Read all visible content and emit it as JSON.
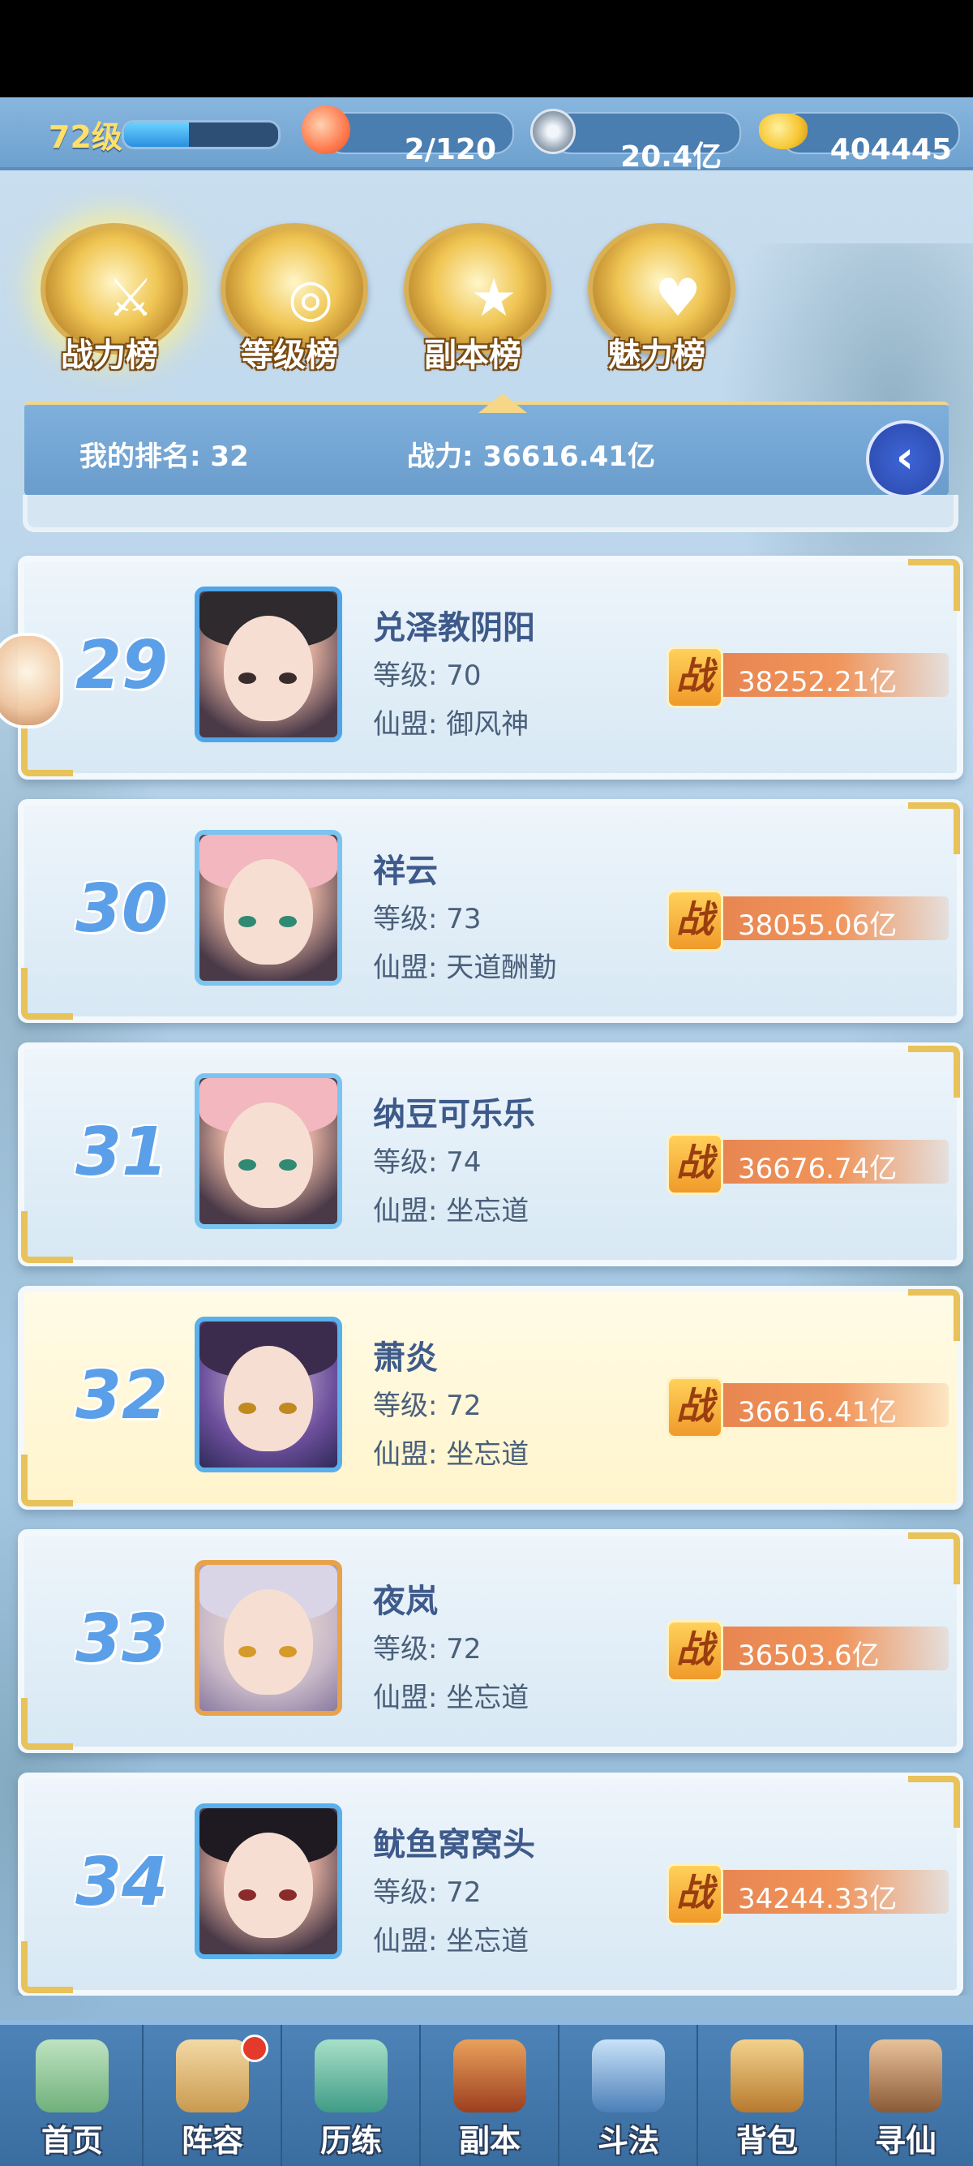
{
  "resources": {
    "level": "72级",
    "exp_fraction": 0.42,
    "stamina": "2/120",
    "silver": "20.4亿",
    "gold": "404445"
  },
  "tabs": [
    {
      "label": "战力榜",
      "icon": "sword-emblem-icon",
      "active": true
    },
    {
      "label": "等级榜",
      "icon": "drum-emblem-icon",
      "active": false
    },
    {
      "label": "副本榜",
      "icon": "star-emblem-icon",
      "active": false
    },
    {
      "label": "魅力榜",
      "icon": "heart-emblem-icon",
      "active": false
    }
  ],
  "my_rank": {
    "rank_text": "我的排名: 32",
    "power_text": "战力: 36616.41亿"
  },
  "players": [
    {
      "rank": "29",
      "name": "兑泽教阴阳",
      "level": "等级: 70",
      "guild": "仙盟: 御风神",
      "power": "38252.21亿",
      "highlight": false
    },
    {
      "rank": "30",
      "name": "祥云",
      "level": "等级: 73",
      "guild": "仙盟: 天道酬勤",
      "power": "38055.06亿",
      "highlight": false
    },
    {
      "rank": "31",
      "name": "纳豆可乐乐",
      "level": "等级: 74",
      "guild": "仙盟: 坐忘道",
      "power": "36676.74亿",
      "highlight": false
    },
    {
      "rank": "32",
      "name": "萧炎",
      "level": "等级: 72",
      "guild": "仙盟: 坐忘道",
      "power": "36616.41亿",
      "highlight": true
    },
    {
      "rank": "33",
      "name": "夜岚",
      "level": "等级: 72",
      "guild": "仙盟: 坐忘道",
      "power": "36503.6亿",
      "highlight": false
    },
    {
      "rank": "34",
      "name": "鱿鱼窝窝头",
      "level": "等级: 72",
      "guild": "仙盟: 坐忘道",
      "power": "34244.33亿",
      "highlight": false
    }
  ],
  "power_badge": "战",
  "nav": [
    {
      "label": "首页",
      "icon": "home-icon"
    },
    {
      "label": "阵容",
      "icon": "lineup-icon",
      "badge": true
    },
    {
      "label": "历练",
      "icon": "training-icon"
    },
    {
      "label": "副本",
      "icon": "dungeon-icon"
    },
    {
      "label": "斗法",
      "icon": "battle-icon"
    },
    {
      "label": "背包",
      "icon": "bag-icon"
    },
    {
      "label": "寻仙",
      "icon": "seek-immortal-icon"
    }
  ],
  "colors": {
    "accent_gold": "#e8c25a",
    "rank_blue": "#5a9fe8",
    "power_orange": "#e57f4c",
    "highlight_bg": "#fffbe6"
  }
}
